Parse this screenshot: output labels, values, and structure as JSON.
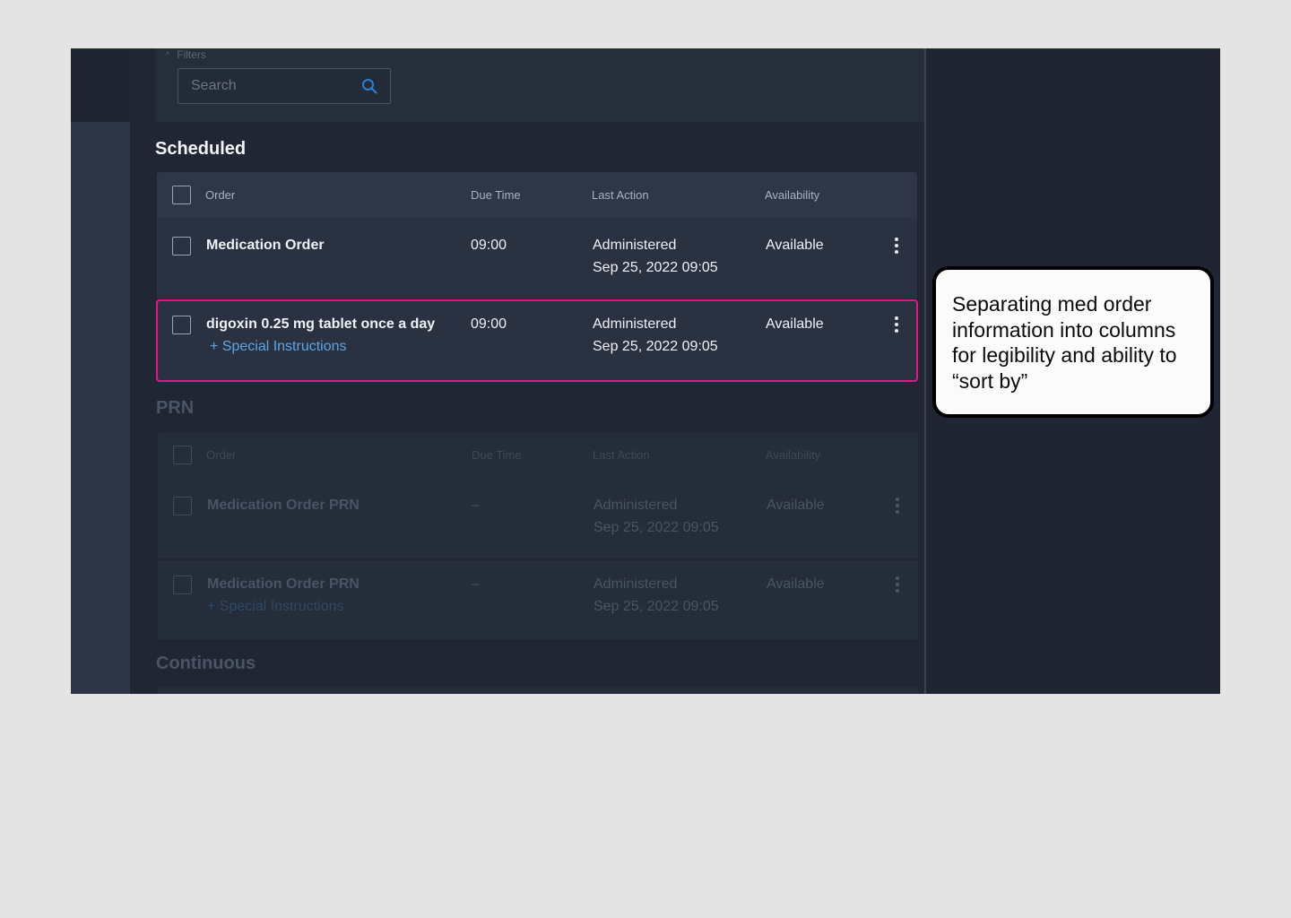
{
  "filters": {
    "label": "Filters",
    "search_placeholder": "Search"
  },
  "columns": {
    "order": "Order",
    "due_time": "Due Time",
    "last_action": "Last Action",
    "availability": "Availability"
  },
  "scheduled": {
    "title": "Scheduled",
    "rows": [
      {
        "order": "Medication Order",
        "special": "",
        "due_time": "09:00",
        "last_action": "Administered",
        "last_action_time": "Sep 25, 2022 09:05",
        "availability": "Available"
      },
      {
        "order": "digoxin 0.25 mg tablet once a day",
        "special": "+ Special Instructions",
        "due_time": "09:00",
        "last_action": "Administered",
        "last_action_time": "Sep 25, 2022 09:05",
        "availability": "Available"
      }
    ]
  },
  "prn": {
    "title": "PRN",
    "rows": [
      {
        "order": "Medication Order PRN",
        "special": "",
        "due_time": "–",
        "last_action": "Administered",
        "last_action_time": "Sep 25, 2022 09:05",
        "availability": "Available"
      },
      {
        "order": "Medication Order PRN",
        "special": "+ Special Instructions",
        "due_time": "–",
        "last_action": "Administered",
        "last_action_time": "Sep 25, 2022 09:05",
        "availability": "Available"
      }
    ]
  },
  "continuous": {
    "title": "Continuous"
  },
  "annotation": {
    "text": "Separating med order information into columns for legibility and ability to “sort by”"
  },
  "colors": {
    "highlight": "#e0168a",
    "link": "#5aa6e6",
    "panel": "#202634",
    "row": "#2a3242"
  },
  "icons": {
    "search": "search-icon",
    "row_menu": "more-vertical-icon"
  }
}
